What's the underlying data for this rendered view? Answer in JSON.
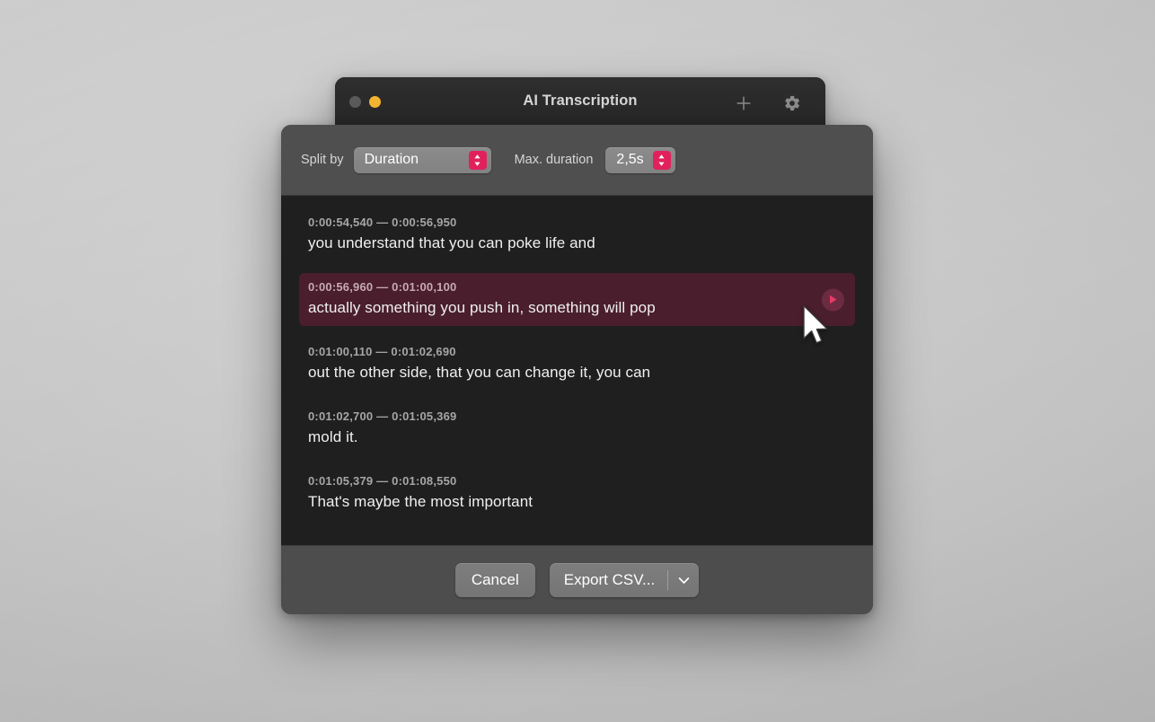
{
  "window": {
    "title": "AI Transcription",
    "traffic_lights": [
      {
        "name": "close",
        "color": "#5c5c5c"
      },
      {
        "name": "minimize",
        "color": "#f7b731"
      }
    ],
    "toolbar_icons": [
      {
        "name": "add-icon",
        "glyph": "+"
      },
      {
        "name": "settings-gear-icon",
        "glyph": "gear"
      }
    ]
  },
  "sheet": {
    "toolbar": {
      "split_by_label": "Split by",
      "split_by_value": "Duration",
      "max_duration_label": "Max. duration",
      "max_duration_value": "2,5s"
    },
    "segments": [
      {
        "time": "0:00:54,540 — 0:00:56,950",
        "text": "you understand that you can poke life and",
        "selected": false
      },
      {
        "time": "0:00:56,960 — 0:01:00,100",
        "text": "actually something you push in, something will pop",
        "selected": true
      },
      {
        "time": "0:01:00,110 — 0:01:02,690",
        "text": "out the other side, that you can change it, you can",
        "selected": false
      },
      {
        "time": "0:01:02,700 — 0:01:05,369",
        "text": "mold it.",
        "selected": false
      },
      {
        "time": "0:01:05,379 — 0:01:08,550",
        "text": "That's maybe the most important",
        "selected": false
      }
    ],
    "footer": {
      "cancel_label": "Cancel",
      "export_label": "Export CSV...",
      "export_menu_icon": "chevron-down-icon"
    }
  },
  "colors": {
    "accent": "#e0215c",
    "selected_row": "#4a1e2d",
    "list_background": "#1f1f1f",
    "sheet_background": "#4d4d4d",
    "window_background": "#282828"
  },
  "cursor": {
    "type": "arrow-pointer"
  }
}
